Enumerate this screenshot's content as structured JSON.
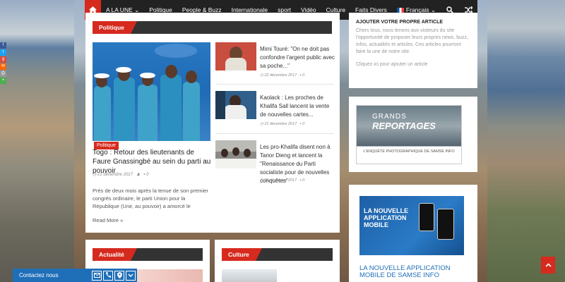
{
  "nav": {
    "items": [
      "A LA UNE",
      "Politique",
      "People & Buzz",
      "Internationale",
      "sport",
      "Vidéo",
      "Culture",
      "Faits Divers",
      "Français"
    ]
  },
  "sections": {
    "politique": "Politique",
    "actualite": "Actualité",
    "culture": "Culture"
  },
  "featured": {
    "category": "Politique",
    "title": "Togo : Retour des lieutenants de Faure Gnassingbé au sein du parti au pouvoir",
    "date": "21 décembre 2017",
    "comments": "0",
    "excerpt": "Près de deux mois après la tenue de son premier congrès ordinaire, le parti Union pour la République (Unir, au pouvoir) a amorcé le",
    "read_more": "Read More »"
  },
  "side_articles": [
    {
      "title": "Mimi Touré: \"On ne doit pas confondre l'argent public avec sa poche...\"",
      "date": "22 décembre 2017",
      "comments": "0"
    },
    {
      "title": "Kaolack : Les proches de Khalifa Sall lancent la vente de nouvelles cartes...",
      "date": "21 décembre 2017",
      "comments": "0"
    },
    {
      "title": "Les pro-Khalifa disent non à Tanor Dieng et lancent la \"Renaissance du Parti socialiste pour de nouvelles conquêtes\"",
      "date": "21 décembre 2017",
      "comments": "0"
    }
  ],
  "sidebar": {
    "article_title": "AJOUTER VOTRE PROPRE ARTICLE",
    "article_text": "Chers tous, nous tenons aux visiteurs du site l'opportunité de proposer leurs propres news, buzz, infos, actualités et articles. Ces articles pourront faire la une de notre site.",
    "article_link": "Cliquez ici pour ajouter un article",
    "grands_reportages_1": "GRANDS",
    "grands_reportages_2": "REPORTAGES",
    "grands_caption": "L'ENQUÊTE PHOTOGRAPHIQUE DE SAMSE INFO",
    "app_line1": "LA NOUVELLE",
    "app_line2": "APPLICATION",
    "app_line3": "MOBILE",
    "app_caption": "LA NOUVELLE APPLICATION MOBILE DE SAMSE INFO"
  },
  "contact": {
    "label": "Contactez nous"
  },
  "colors": {
    "accent": "#d62a1e",
    "nav_bg": "#222222",
    "contact_bg": "#1f6fb8"
  }
}
